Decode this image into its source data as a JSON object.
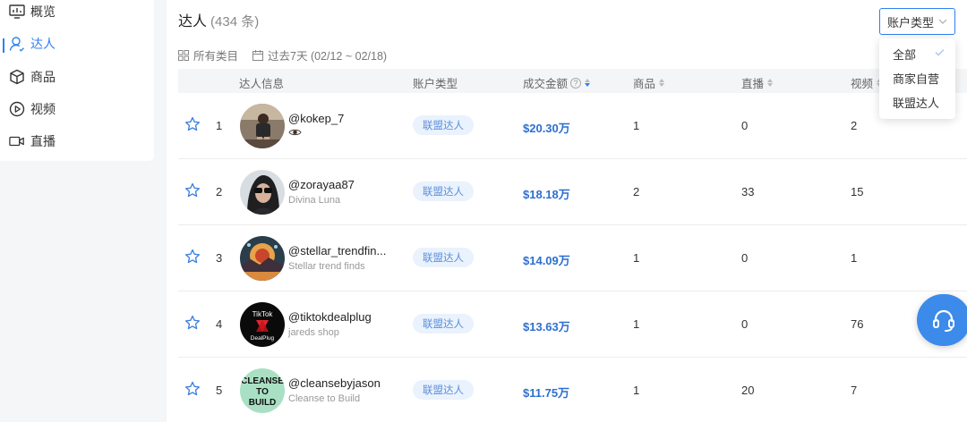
{
  "sidebar": {
    "items": [
      {
        "label": "概览",
        "icon": "overview-icon"
      },
      {
        "label": "达人",
        "icon": "creator-icon",
        "active": true
      },
      {
        "label": "商品",
        "icon": "product-box-icon"
      },
      {
        "label": "视频",
        "icon": "video-play-icon"
      },
      {
        "label": "直播",
        "icon": "live-camera-icon"
      }
    ]
  },
  "header": {
    "title": "达人",
    "count": "(434 条)"
  },
  "filters": {
    "category": "所有类目",
    "date_range": "过去7天 (02/12 ~ 02/18)"
  },
  "account_type_select": {
    "label": "账户类型",
    "options": [
      "全部",
      "商家自营",
      "联盟达人"
    ],
    "selected": "全部"
  },
  "table": {
    "headers": {
      "creator": "达人信息",
      "account_type": "账户类型",
      "gmv": "成交金额",
      "products": "商品",
      "live": "直播",
      "video": "视频"
    },
    "rows": [
      {
        "rank": "1",
        "handle": "@kokep_7",
        "sub": "",
        "account_type": "联盟达人",
        "gmv": "$20.30万",
        "products": "1",
        "live": "0",
        "video": "2"
      },
      {
        "rank": "2",
        "handle": "@zorayaa87",
        "sub": "Divina Luna",
        "account_type": "联盟达人",
        "gmv": "$18.18万",
        "products": "2",
        "live": "33",
        "video": "15"
      },
      {
        "rank": "3",
        "handle": "@stellar_trendfin...",
        "sub": "Stellar trend finds",
        "account_type": "联盟达人",
        "gmv": "$14.09万",
        "products": "1",
        "live": "0",
        "video": "1"
      },
      {
        "rank": "4",
        "handle": "@tiktokdealplug",
        "sub": "jareds shop",
        "account_type": "联盟达人",
        "gmv": "$13.63万",
        "products": "1",
        "live": "0",
        "video": "76"
      },
      {
        "rank": "5",
        "handle": "@cleansebyjason",
        "sub": "Cleanse to Build",
        "account_type": "联盟达人",
        "gmv": "$11.75万",
        "products": "1",
        "live": "20",
        "video": "7"
      }
    ]
  },
  "avatar_text": {
    "tiktok_line1": "TikTok",
    "tiktok_line2": "DealPlug",
    "cleanse_line1": "CLEANSE",
    "cleanse_line2": "TO",
    "cleanse_line3": "BUILD"
  },
  "colors": {
    "accent": "#2d7ff0",
    "amount": "#2d6fd0",
    "badge_bg": "#eaf2fd",
    "support_button": "#3c8bea"
  }
}
